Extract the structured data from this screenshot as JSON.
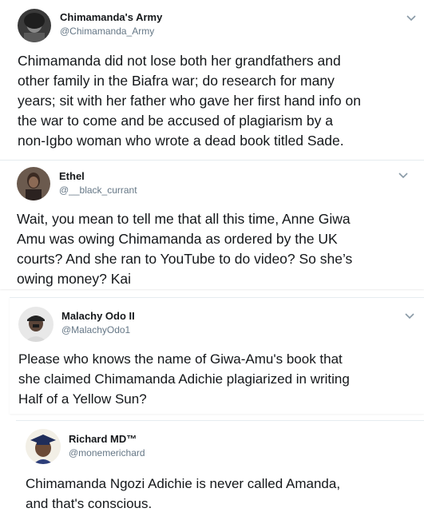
{
  "tweets": [
    {
      "display_name": "Chimamanda's Army",
      "handle": "@Chimamanda_Army",
      "avatar_icon": "bw-portrait-avatar-icon",
      "lines": [
        "Chimamanda did not lose both her grandfathers and",
        "other family in the Biafra war; do research for many",
        "years; sit with her father who gave her first hand info on",
        "the war to come and be accused of plagiarism by a",
        "non-Igbo woman who wrote a dead book titled Sade."
      ]
    },
    {
      "display_name": "Ethel",
      "handle": "@__black_currant",
      "avatar_icon": "woman-portrait-avatar-icon",
      "lines": [
        "Wait, you mean to tell me that all this time, Anne Giwa",
        "Amu was owing Chimamanda as ordered by the UK",
        "courts? And she ran to YouTube to do video? So she’s",
        "owing money? Kai"
      ]
    },
    {
      "display_name": "Malachy Odo II",
      "handle": "@MalachyOdo1",
      "avatar_icon": "man-with-cap-avatar-icon",
      "lines": [
        "Please who knows the name of Giwa-Amu's book that",
        "she claimed Chimamanda Adichie plagiarized in writing",
        "Half of a Yellow Sun?"
      ]
    },
    {
      "display_name": "Richard MD™",
      "handle": "@monemerichard",
      "avatar_icon": "graduation-cap-avatar-icon",
      "lines": [
        "Chimamanda Ngozi Adichie is never called Amanda,",
        "and that's conscious."
      ]
    }
  ],
  "colors": {
    "text": "#14171a",
    "secondary": "#657786",
    "divider": "#e6ecf0"
  },
  "icons": {
    "menu": "chevron-down-icon"
  }
}
